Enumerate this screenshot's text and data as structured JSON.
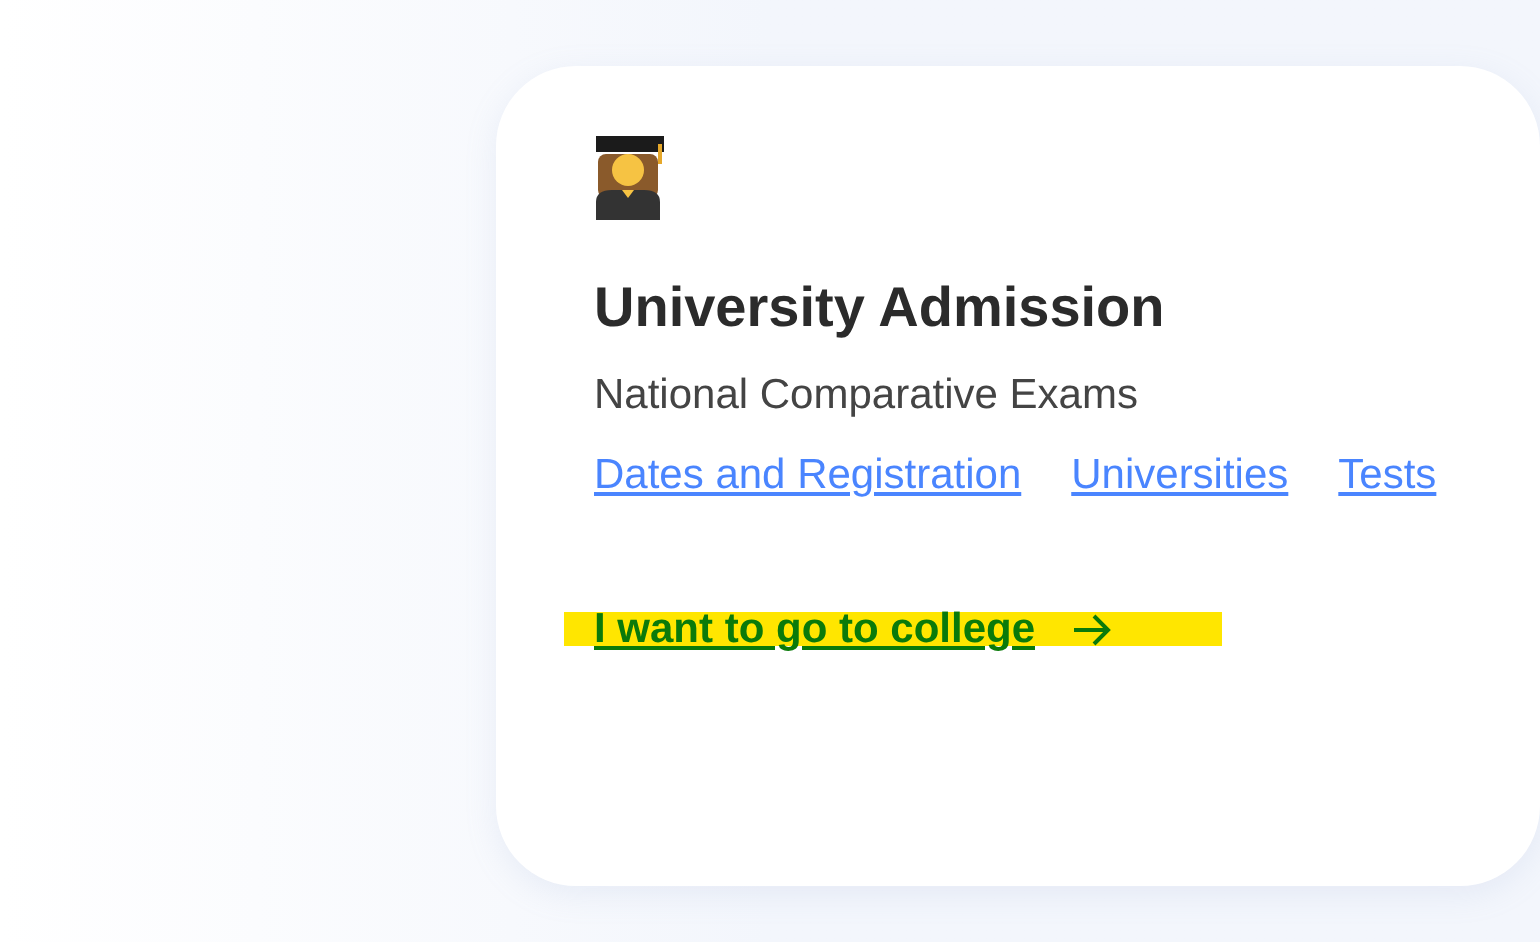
{
  "card": {
    "title": "University Admission",
    "subtitle": "National Comparative Exams",
    "links": [
      "Dates and Registration",
      "Universities",
      "Tests"
    ],
    "cta": {
      "label": "I want to go to college",
      "highlighted": true
    }
  }
}
